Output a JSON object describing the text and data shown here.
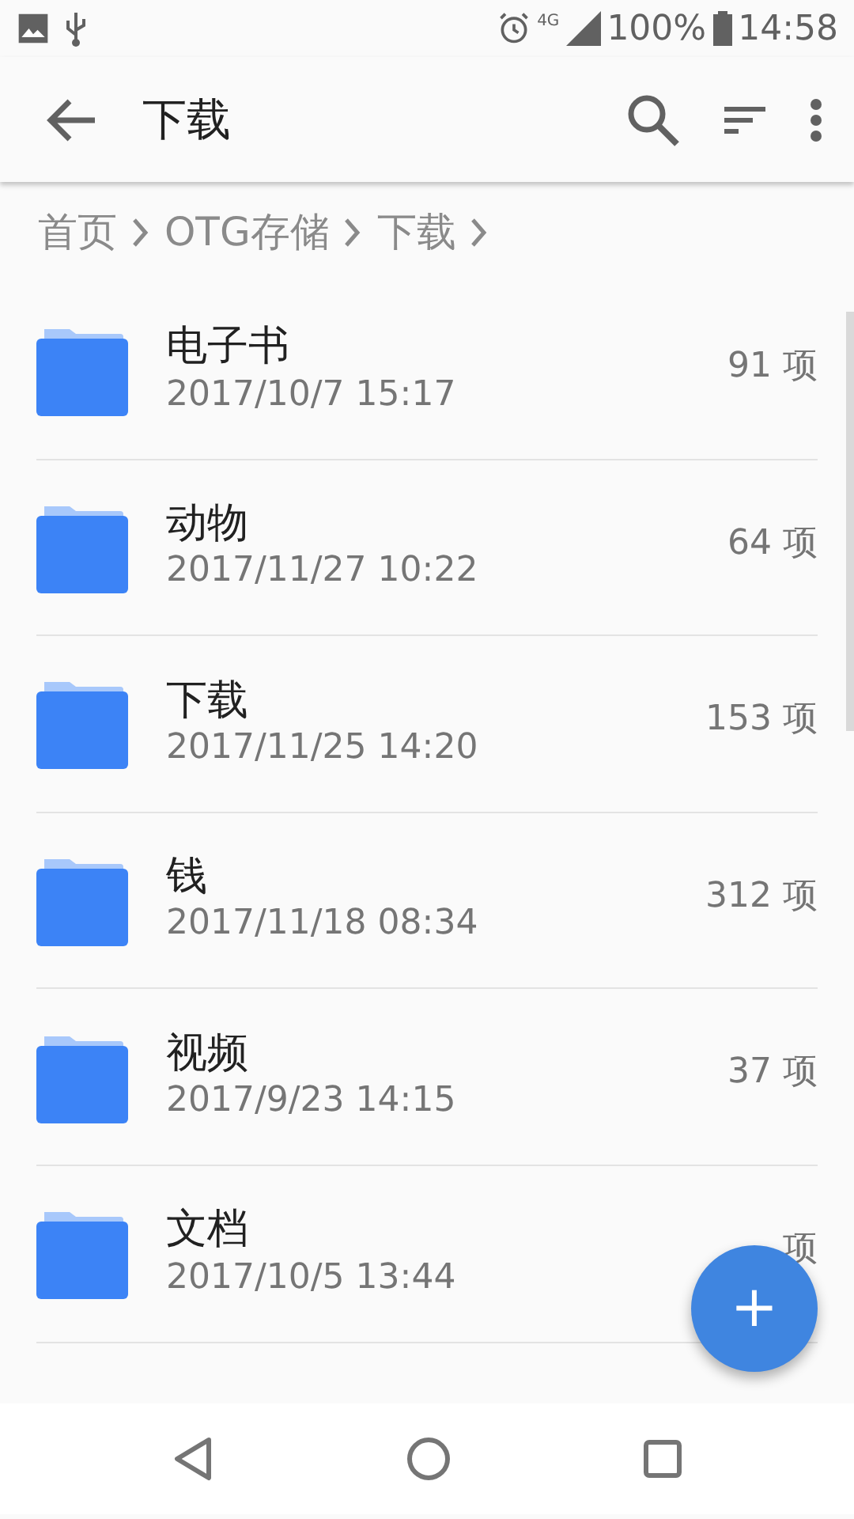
{
  "status_bar": {
    "battery": "100%",
    "time": "14:58",
    "network": "4G"
  },
  "toolbar": {
    "title": "下载"
  },
  "breadcrumb": [
    "首页",
    "OTG存储",
    "下载"
  ],
  "folders": [
    {
      "name": "电子书",
      "date": "2017/10/7 15:17",
      "count": "91 项"
    },
    {
      "name": "动物",
      "date": "2017/11/27 10:22",
      "count": "64 项"
    },
    {
      "name": "下载",
      "date": "2017/11/25 14:20",
      "count": "153 项"
    },
    {
      "name": "钱",
      "date": "2017/11/18 08:34",
      "count": "312 项"
    },
    {
      "name": "视频",
      "date": "2017/9/23 14:15",
      "count": "37 项"
    },
    {
      "name": "文档",
      "date": "2017/10/5 13:44",
      "count": "项"
    }
  ],
  "fab": {
    "label": "+"
  }
}
